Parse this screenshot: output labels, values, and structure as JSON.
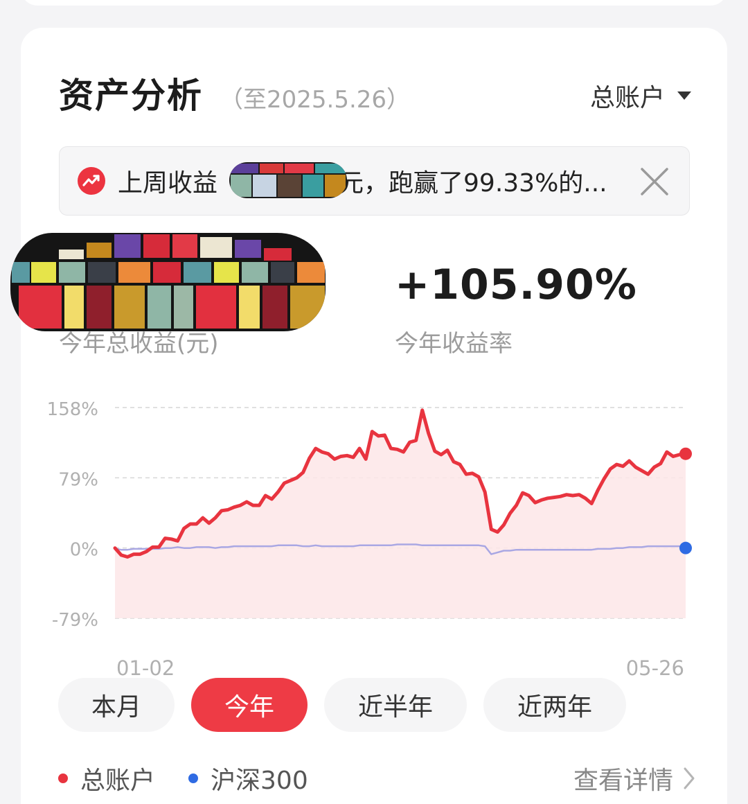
{
  "header": {
    "title": "资产分析",
    "as_of": "（至2025.5.26）",
    "account_selector": "总账户"
  },
  "notice": {
    "prefix": "上周收益",
    "suffix": "元，跑赢了99.33%的..."
  },
  "stats": {
    "total_profit_label": "今年总收益(元)",
    "return_rate": "+105.90%",
    "return_rate_label": "今年收益率"
  },
  "chart_data": {
    "type": "line",
    "y_ticks": [
      "158%",
      "79%",
      "0%",
      "-79%"
    ],
    "x_labels": [
      "01-02",
      "05-26"
    ],
    "ylim": [
      -79,
      158
    ],
    "series": [
      {
        "name": "总账户",
        "color": "#e8343f",
        "values": [
          0,
          -8,
          -10,
          -7,
          -7,
          -4,
          1,
          1,
          11,
          10,
          8,
          22,
          27,
          27,
          34,
          28,
          34,
          42,
          43,
          46,
          48,
          52,
          48,
          48,
          59,
          55,
          63,
          73,
          76,
          79,
          85,
          101,
          112,
          108,
          106,
          100,
          103,
          104,
          102,
          112,
          100,
          131,
          126,
          127,
          112,
          111,
          108,
          119,
          121,
          155,
          129,
          109,
          105,
          110,
          97,
          94,
          83,
          84,
          80,
          63,
          21,
          18,
          26,
          39,
          48,
          62,
          59,
          51,
          54,
          56,
          57,
          58,
          60,
          59,
          60,
          56,
          50,
          65,
          78,
          89,
          94,
          92,
          98,
          91,
          87,
          83,
          91,
          95,
          108,
          103,
          105,
          106
        ]
      },
      {
        "name": "沪深300",
        "color": "#a9a7e3",
        "values": [
          -1,
          -2,
          -2,
          -1,
          -1,
          -1,
          -1,
          -1,
          0,
          0,
          1,
          0,
          0,
          1,
          1,
          1,
          0,
          1,
          1,
          2,
          2,
          2,
          2,
          2,
          2,
          2,
          3,
          3,
          3,
          3,
          2,
          2,
          3,
          2,
          2,
          2,
          2,
          2,
          2,
          3,
          3,
          3,
          3,
          3,
          3,
          4,
          4,
          4,
          4,
          3,
          3,
          3,
          3,
          3,
          3,
          3,
          3,
          3,
          3,
          2,
          -7,
          -5,
          -3,
          -3,
          -2,
          -2,
          -2,
          -2,
          -2,
          -2,
          -2,
          -2,
          -2,
          -2,
          -2,
          -2,
          -2,
          -1,
          -1,
          -1,
          0,
          0,
          1,
          1,
          1,
          2,
          2,
          2,
          2,
          2,
          2,
          1
        ]
      }
    ]
  },
  "range_tabs": [
    {
      "label": "本月",
      "active": false
    },
    {
      "label": "今年",
      "active": true
    },
    {
      "label": "近半年",
      "active": false
    },
    {
      "label": "近两年",
      "active": false
    }
  ],
  "legend": {
    "account": {
      "label": "总账户",
      "color": "#e8343f"
    },
    "index": {
      "label": "沪深300",
      "color": "#2f6be3"
    },
    "detail_label": "查看详情"
  },
  "colors": {
    "accent": "#ee3b45"
  }
}
